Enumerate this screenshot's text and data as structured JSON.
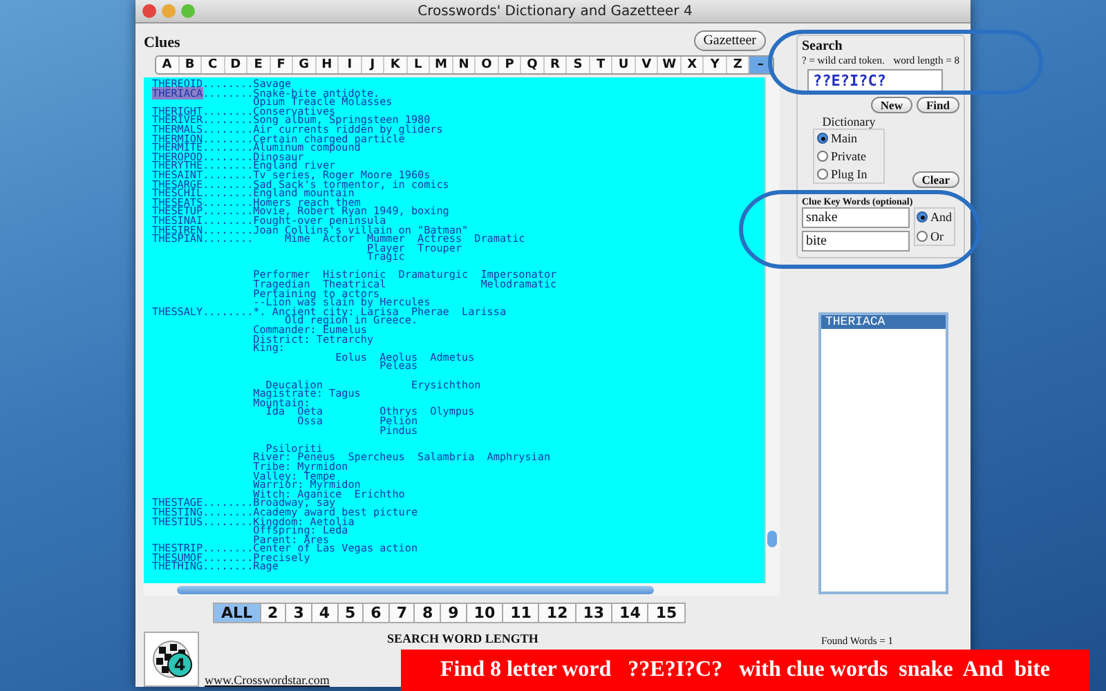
{
  "window": {
    "title": "Crosswords' Dictionary and Gazetteer 4"
  },
  "clues": {
    "title": "Clues",
    "gazetteer_button": "Gazetteer",
    "letters": [
      {
        "label": "A",
        "selected": false
      },
      {
        "label": "B",
        "selected": false
      },
      {
        "label": "C",
        "selected": false
      },
      {
        "label": "D",
        "selected": false
      },
      {
        "label": "E",
        "selected": false
      },
      {
        "label": "F",
        "selected": false
      },
      {
        "label": "G",
        "selected": false
      },
      {
        "label": "H",
        "selected": false
      },
      {
        "label": "I",
        "selected": false
      },
      {
        "label": "J",
        "selected": false
      },
      {
        "label": "K",
        "selected": false
      },
      {
        "label": "L",
        "selected": false
      },
      {
        "label": "M",
        "selected": false
      },
      {
        "label": "N",
        "selected": false
      },
      {
        "label": "O",
        "selected": false
      },
      {
        "label": "P",
        "selected": false
      },
      {
        "label": "Q",
        "selected": false
      },
      {
        "label": "R",
        "selected": false
      },
      {
        "label": "S",
        "selected": false
      },
      {
        "label": "T",
        "selected": false
      },
      {
        "label": "U",
        "selected": false
      },
      {
        "label": "V",
        "selected": false
      },
      {
        "label": "W",
        "selected": false
      },
      {
        "label": "X",
        "selected": false
      },
      {
        "label": "Y",
        "selected": false
      },
      {
        "label": "Z",
        "selected": false
      },
      {
        "label": "–",
        "selected": true
      }
    ],
    "lines": [
      {
        "kind": "entry",
        "head": "THEREOID",
        "text": "........Savage",
        "selected": false
      },
      {
        "kind": "entry",
        "head": "THERIACA",
        "text": "........Snake-bite antidote.",
        "selected": true
      },
      {
        "kind": "text",
        "text": "                Opium Treacle Molasses"
      },
      {
        "kind": "entry",
        "head": "THERIGHT",
        "text": "........Conservatives",
        "selected": false
      },
      {
        "kind": "entry",
        "head": "THERIVER",
        "text": "........Song album, Springsteen 1980",
        "selected": false
      },
      {
        "kind": "entry",
        "head": "THERMALS",
        "text": "........Air currents ridden by gliders",
        "selected": false
      },
      {
        "kind": "entry",
        "head": "THERMION",
        "text": "........Certain charged particle",
        "selected": false
      },
      {
        "kind": "entry",
        "head": "THERMITE",
        "text": "........Aluminum compound",
        "selected": false
      },
      {
        "kind": "entry",
        "head": "THEROPOD",
        "text": "........Dinosaur",
        "selected": false
      },
      {
        "kind": "entry",
        "head": "THERYTHE",
        "text": "........England river",
        "selected": false
      },
      {
        "kind": "entry",
        "head": "THESAINT",
        "text": "........Tv series, Roger Moore 1960s",
        "selected": false
      },
      {
        "kind": "entry",
        "head": "THESARGE",
        "text": "........Sad Sack's tormentor, in comics",
        "selected": false
      },
      {
        "kind": "entry",
        "head": "THESCHIL",
        "text": "........England mountain",
        "selected": false
      },
      {
        "kind": "entry",
        "head": "THESEATS",
        "text": "........Homers reach them",
        "selected": false
      },
      {
        "kind": "entry",
        "head": "THESETUP",
        "text": "........Movie, Robert Ryan 1949, boxing",
        "selected": false
      },
      {
        "kind": "entry",
        "head": "THESINAI",
        "text": "........Fought-over peninsula",
        "selected": false
      },
      {
        "kind": "entry",
        "head": "THESIREN",
        "text": "........Joan Collins's villain on \"Batman\"",
        "selected": false
      },
      {
        "kind": "entry",
        "head": "THESPIAN",
        "text": "........     Mime  Actor  Mummer  Actress  Dramatic",
        "selected": false
      },
      {
        "kind": "text",
        "text": "                                  Player  Trouper"
      },
      {
        "kind": "text",
        "text": "                                  Tragic"
      },
      {
        "kind": "blank"
      },
      {
        "kind": "text",
        "text": "                Performer  Histrionic  Dramaturgic  Impersonator"
      },
      {
        "kind": "text",
        "text": "                Tragedian  Theatrical               Melodramatic"
      },
      {
        "kind": "text",
        "text": "                Pertaining to actors"
      },
      {
        "kind": "text",
        "text": "                --Lion was slain by Hercules"
      },
      {
        "kind": "entry",
        "head": "THESSALY",
        "text": "........*. Ancient city: Larisa  Pherae  Larissa",
        "selected": false
      },
      {
        "kind": "text",
        "text": "                     Old region in Greece."
      },
      {
        "kind": "text",
        "text": "                Commander: Eumelus"
      },
      {
        "kind": "text",
        "text": "                District: Tetrarchy"
      },
      {
        "kind": "text",
        "text": "                King:"
      },
      {
        "kind": "text",
        "text": "                             Eolus  Aeolus  Admetus"
      },
      {
        "kind": "text",
        "text": "                                    Peleas"
      },
      {
        "kind": "blank"
      },
      {
        "kind": "text",
        "text": "                  Deucalion              Erysichthon"
      },
      {
        "kind": "text",
        "text": "                Magistrate: Tagus"
      },
      {
        "kind": "text",
        "text": "                Mountain:"
      },
      {
        "kind": "text",
        "text": "                  Ida  Oeta         Othrys  Olympus"
      },
      {
        "kind": "text",
        "text": "                       Ossa         Pelion"
      },
      {
        "kind": "text",
        "text": "                                    Pindus"
      },
      {
        "kind": "blank"
      },
      {
        "kind": "text",
        "text": "                  Psiloriti"
      },
      {
        "kind": "text",
        "text": "                River: Peneus  Spercheus  Salambria  Amphrysian"
      },
      {
        "kind": "text",
        "text": "                Tribe: Myrmidon"
      },
      {
        "kind": "text",
        "text": "                Valley: Tempe"
      },
      {
        "kind": "text",
        "text": "                Warrior: Myrmidon"
      },
      {
        "kind": "text",
        "text": "                Witch: Aganice  Erichtho"
      },
      {
        "kind": "entry",
        "head": "THESTAGE",
        "text": "........Broadway, say",
        "selected": false
      },
      {
        "kind": "entry",
        "head": "THESTING",
        "text": "........Academy award best picture",
        "selected": false
      },
      {
        "kind": "entry",
        "head": "THESTIUS",
        "text": "........Kingdom: Aetolia",
        "selected": false
      },
      {
        "kind": "text",
        "text": "                Offspring: Leda"
      },
      {
        "kind": "text",
        "text": "                Parent: Ares"
      },
      {
        "kind": "entry",
        "head": "THESTRIP",
        "text": "........Center of Las Vegas action",
        "selected": false
      },
      {
        "kind": "entry",
        "head": "THESUMOF",
        "text": "........Precisely",
        "selected": false
      },
      {
        "kind": "entry",
        "head": "THETHING",
        "text": "........Rage",
        "selected": false
      }
    ]
  },
  "length_bar": {
    "options": [
      {
        "label": "ALL",
        "selected": true
      },
      {
        "label": "2",
        "selected": false
      },
      {
        "label": "3",
        "selected": false
      },
      {
        "label": "4",
        "selected": false
      },
      {
        "label": "5",
        "selected": false
      },
      {
        "label": "6",
        "selected": false
      },
      {
        "label": "7",
        "selected": false
      },
      {
        "label": "8",
        "selected": false
      },
      {
        "label": "9",
        "selected": false
      },
      {
        "label": "10",
        "selected": false
      },
      {
        "label": "11",
        "selected": false
      },
      {
        "label": "12",
        "selected": false
      },
      {
        "label": "13",
        "selected": false
      },
      {
        "label": "14",
        "selected": false
      },
      {
        "label": "15",
        "selected": false
      }
    ],
    "caption": "SEARCH WORD LENGTH"
  },
  "footer": {
    "logo_text": "4",
    "link": "www.Crosswordstar.com",
    "found": "Found Words = 1"
  },
  "search": {
    "title": "Search",
    "hint": "? = wild card token.",
    "word_length": "word length = 8",
    "pattern": "??E?I?C?",
    "new_button": "New",
    "find_button": "Find",
    "clear_button": "Clear",
    "dictionary": {
      "title": "Dictionary",
      "options": [
        {
          "label": "Main",
          "selected": true
        },
        {
          "label": "Private",
          "selected": false
        },
        {
          "label": "Plug In",
          "selected": false
        }
      ]
    },
    "key_words": {
      "title": "Clue Key Words  (optional)",
      "words": [
        "snake",
        "bite"
      ],
      "modes": [
        {
          "label": "And",
          "selected": true
        },
        {
          "label": "Or",
          "selected": false
        }
      ]
    }
  },
  "results": [
    {
      "word": "THERIACA",
      "selected": true
    }
  ],
  "banner": "Find 8 letter word   ??E?I?C?   with clue words  snake  And  bite"
}
